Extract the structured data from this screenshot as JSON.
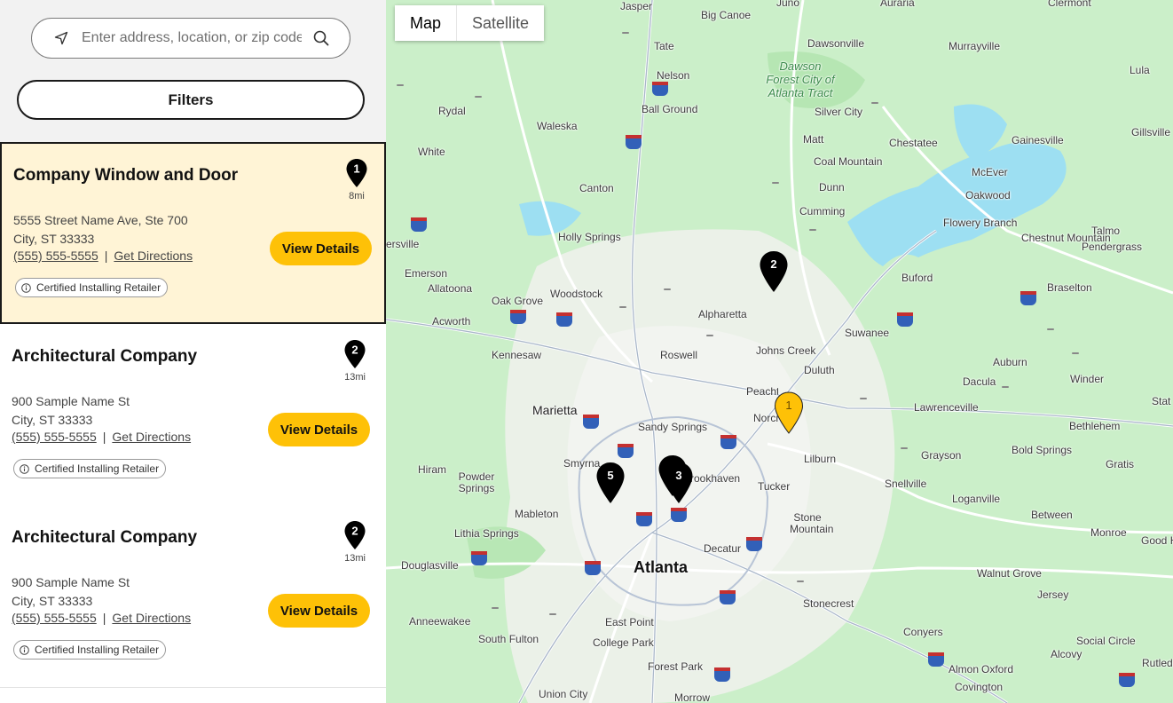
{
  "search": {
    "placeholder": "Enter address, location, or zip code"
  },
  "filters": {
    "label": "Filters"
  },
  "results": [
    {
      "name": "Company Window and Door",
      "pin": "1",
      "distance": "8mi",
      "address_line1": "5555 Street Name Ave, Ste 700",
      "address_line2": "City, ST 33333",
      "phone": "(555) 555-5555",
      "separator": "|",
      "directions": "Get Directions",
      "view_details": "View Details",
      "badge": "Certified Installing Retailer"
    },
    {
      "name": "Architectural Company",
      "pin": "2",
      "distance": "13mi",
      "address_line1": "900 Sample Name St",
      "address_line2": "City, ST 33333",
      "phone": "(555) 555-5555",
      "separator": "|",
      "directions": "Get Directions",
      "view_details": "View Details",
      "badge": "Certified Installing Retailer"
    },
    {
      "name": "Architectural Company",
      "pin": "2",
      "distance": "13mi",
      "address_line1": "900 Sample Name St",
      "address_line2": "City, ST 33333",
      "phone": "(555) 555-5555",
      "separator": "|",
      "directions": "Get Directions",
      "view_details": "View Details",
      "badge": "Certified Installing Retailer"
    }
  ],
  "map": {
    "tabs": {
      "map": "Map",
      "satellite": "Satellite"
    },
    "markers": [
      {
        "label": "1",
        "active": true
      },
      {
        "label": "2",
        "active": false
      },
      {
        "label": "3",
        "active": false
      },
      {
        "label": "4",
        "active": false
      },
      {
        "label": "5",
        "active": false
      }
    ],
    "places": [
      "Jasper",
      "Big Canoe",
      "Juno",
      "Auraria",
      "Clermont",
      "Tate",
      "Dawsonville",
      "Murrayville",
      "Lula",
      "Nelson",
      "Ball Ground",
      "Silver City",
      "Rydal",
      "Waleska",
      "Matt",
      "Chestatee",
      "Gainesville",
      "Gillsville",
      "White",
      "Coal Mountain",
      "McEver",
      "Canton",
      "Dunn",
      "Oakwood",
      "Cumming",
      "Flowery Branch",
      "Talmo",
      "Chestnut Mountain",
      "Pendergrass",
      "Holly Springs",
      "Buford",
      "Braselton",
      "Emerson",
      "Allatoona",
      "Woodstock",
      "Oak Grove",
      "Alpharetta",
      "Acworth",
      "Suwanee",
      "Kennesaw",
      "Roswell",
      "Johns Creek",
      "Auburn",
      "Duluth",
      "Dacula",
      "Winder",
      "Peachtree Corners",
      "Lawrenceville",
      "Marietta",
      "Sandy Springs",
      "Norcross",
      "Bethlehem",
      "Lilburn",
      "Grayson",
      "Bold Springs",
      "Smyrna",
      "Brookhaven",
      "Tucker",
      "Snellville",
      "Gratis",
      "Hiram",
      "Powder Springs",
      "Loganville",
      "Mableton",
      "Stone Mountain",
      "Between",
      "Lithia Springs",
      "Decatur",
      "Monroe",
      "Good Hope",
      "Douglasville",
      "Atlanta",
      "Walnut Grove",
      "Stonecrest",
      "Jersey",
      "Anneewakee",
      "East Point",
      "Conyers",
      "South Fulton",
      "College Park",
      "Social Circle",
      "Alcovy",
      "Rutledge",
      "Forest Park",
      "Almon",
      "Oxford",
      "Union City",
      "Morrow",
      "Covington"
    ],
    "park": "Dawson Forest City of Atlanta Tract",
    "partial": [
      "ersville",
      "Stat"
    ]
  }
}
